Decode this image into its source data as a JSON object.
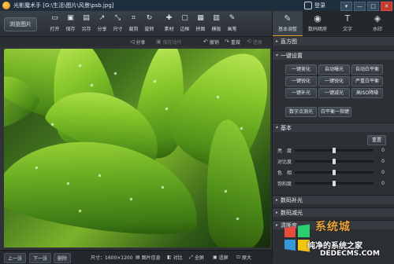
{
  "titlebar": {
    "title": "光影魔术手 [G:\\生活\\图片\\风景\\psb.jpg]",
    "login_label": "登录",
    "buttons": [
      "▾",
      "—",
      "□",
      "✕"
    ]
  },
  "toolbar": {
    "browse_label": "浏览图片",
    "tools": [
      {
        "icon": "open-icon",
        "glyph": "▭",
        "label": "打开"
      },
      {
        "icon": "save-icon",
        "glyph": "▣",
        "label": "保存"
      },
      {
        "icon": "save-as-icon",
        "glyph": "▤",
        "label": "另存"
      },
      {
        "icon": "share-icon",
        "glyph": "↗",
        "label": "分享"
      },
      {
        "icon": "resize-icon",
        "glyph": "⤡",
        "label": "尺寸"
      },
      {
        "icon": "crop-icon",
        "glyph": "⌗",
        "label": "裁剪"
      },
      {
        "icon": "rotate-icon",
        "glyph": "↻",
        "label": "旋转"
      },
      {
        "icon": "material-icon",
        "glyph": "✚",
        "label": "素材"
      },
      {
        "icon": "border-icon",
        "glyph": "▢",
        "label": "边框"
      },
      {
        "icon": "puzzle-icon",
        "glyph": "▦",
        "label": "拼图"
      },
      {
        "icon": "template-icon",
        "glyph": "▥",
        "label": "模板"
      },
      {
        "icon": "brush-icon",
        "glyph": "✎",
        "label": "画笔"
      }
    ]
  },
  "subtoolbar": {
    "share": "分享",
    "save_action": "保存动作",
    "undo": "撤销",
    "redo": "重做",
    "restore": "还原"
  },
  "bottombar": {
    "prev": "上一张",
    "next": "下一张",
    "delete": "删除",
    "size": "尺寸：1600×1200",
    "info": "图片信息",
    "compare": "对比",
    "fullscreen": "全屏",
    "fit": "适屏",
    "original": "原大"
  },
  "panel": {
    "tabs": [
      {
        "icon": "basic-adjust-icon",
        "glyph": "✎",
        "label": "基本调整"
      },
      {
        "icon": "digital-darkroom-icon",
        "glyph": "◉",
        "label": "数码暗房"
      },
      {
        "icon": "text-icon",
        "glyph": "T",
        "label": "文字"
      },
      {
        "icon": "watermark-icon",
        "glyph": "◈",
        "label": "水印"
      }
    ],
    "sections": {
      "histogram": "直方图",
      "one_click": "一键设置",
      "basic": "基本",
      "digital_fill": "数码补光",
      "digital_dim": "数码减光",
      "clarity": "清晰度"
    },
    "one_click_buttons": [
      "一键美化",
      "自动曝光",
      "自动白平衡",
      "一键锐化",
      "一键锐化",
      "严重白平衡",
      "一键补光",
      "一键减光",
      "高ISO降噪"
    ],
    "extra_buttons": [
      "数字点测光",
      "白平衡一指键"
    ],
    "reset_label": "重置",
    "sliders": [
      {
        "label": "亮　度",
        "level": 0.5,
        "value": "0"
      },
      {
        "label": "对比度",
        "level": 0.5,
        "value": "0"
      },
      {
        "label": "色　相",
        "level": 0.5,
        "value": "0"
      },
      {
        "label": "饱和度",
        "level": 0.5,
        "value": "0"
      }
    ]
  },
  "watermark": {
    "brand": "系统城",
    "line1": "纯净的系统之家",
    "line2": "DEDECMS.COM"
  },
  "colors": {
    "accent": "#e7a72c",
    "win_red": "#e74c3c",
    "win_green": "#2ecc71",
    "win_blue": "#3498db",
    "win_yellow": "#f1c40f"
  }
}
